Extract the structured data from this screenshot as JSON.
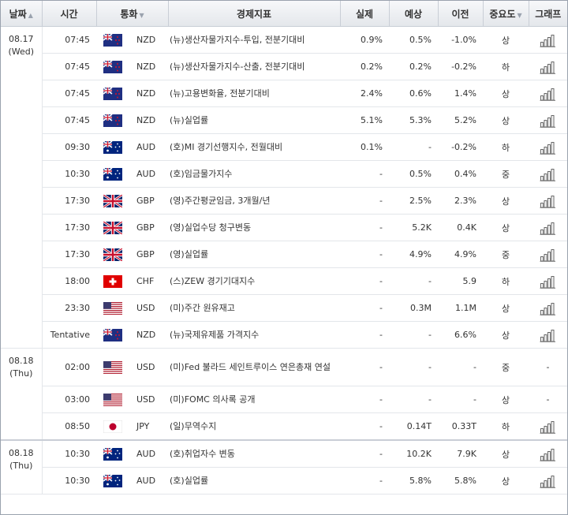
{
  "columns": {
    "date": "날짜",
    "time": "시간",
    "currency": "통화",
    "indicator": "경제지표",
    "actual": "실제",
    "forecast": "예상",
    "previous": "이전",
    "importance": "중요도",
    "graph": "그래프"
  },
  "rows": [
    {
      "date": "08.17",
      "day": "(Wed)",
      "time": "07:45",
      "flag": "nz",
      "currency": "NZD",
      "indicator": "(뉴)생산자물가지수-투입, 전분기대비",
      "actual": "0.9%",
      "forecast": "0.5%",
      "previous": "-1.0%",
      "importance": "상",
      "graph": true
    },
    {
      "time": "07:45",
      "flag": "nz",
      "currency": "NZD",
      "indicator": "(뉴)생산자물가지수-산출, 전분기대비",
      "actual": "0.2%",
      "forecast": "0.2%",
      "previous": "-0.2%",
      "importance": "하",
      "graph": true
    },
    {
      "time": "07:45",
      "flag": "nz",
      "currency": "NZD",
      "indicator": "(뉴)고용변화율, 전분기대비",
      "actual": "2.4%",
      "forecast": "0.6%",
      "previous": "1.4%",
      "importance": "상",
      "graph": true
    },
    {
      "time": "07:45",
      "flag": "nz",
      "currency": "NZD",
      "indicator": "(뉴)실업률",
      "actual": "5.1%",
      "forecast": "5.3%",
      "previous": "5.2%",
      "importance": "상",
      "graph": true
    },
    {
      "time": "09:30",
      "flag": "au",
      "currency": "AUD",
      "indicator": "(호)MI 경기선행지수, 전월대비",
      "actual": "0.1%",
      "forecast": "-",
      "previous": "-0.2%",
      "importance": "하",
      "graph": true
    },
    {
      "time": "10:30",
      "flag": "au",
      "currency": "AUD",
      "indicator": "(호)임금물가지수",
      "actual": "-",
      "forecast": "0.5%",
      "previous": "0.4%",
      "importance": "중",
      "graph": true
    },
    {
      "time": "17:30",
      "flag": "gb",
      "currency": "GBP",
      "indicator": "(영)주간평균임금, 3개월/년",
      "actual": "-",
      "forecast": "2.5%",
      "previous": "2.3%",
      "importance": "상",
      "graph": true
    },
    {
      "time": "17:30",
      "flag": "gb",
      "currency": "GBP",
      "indicator": "(영)실업수당 청구변동",
      "actual": "-",
      "forecast": "5.2K",
      "previous": "0.4K",
      "importance": "상",
      "graph": true
    },
    {
      "time": "17:30",
      "flag": "gb",
      "currency": "GBP",
      "indicator": "(영)실업률",
      "actual": "-",
      "forecast": "4.9%",
      "previous": "4.9%",
      "importance": "중",
      "graph": true
    },
    {
      "time": "18:00",
      "flag": "ch",
      "currency": "CHF",
      "indicator": "(스)ZEW 경기기대지수",
      "actual": "-",
      "forecast": "-",
      "previous": "5.9",
      "importance": "하",
      "graph": true
    },
    {
      "time": "23:30",
      "flag": "us",
      "currency": "USD",
      "indicator": "(미)주간 원유재고",
      "actual": "-",
      "forecast": "0.3M",
      "previous": "1.1M",
      "importance": "상",
      "graph": true
    },
    {
      "time": "Tentative",
      "flag": "nz",
      "currency": "NZD",
      "indicator": "(뉴)국제유제품 가격지수",
      "actual": "-",
      "forecast": "-",
      "previous": "6.6%",
      "importance": "상",
      "graph": true
    },
    {
      "date": "08.18",
      "day": "(Thu)",
      "time": "02:00",
      "flag": "us",
      "currency": "USD",
      "indicator": "(미)Fed 불라드 세인트루이스 연은총재 연설",
      "actual": "-",
      "forecast": "-",
      "previous": "-",
      "importance": "중",
      "graph": false,
      "tall": true
    },
    {
      "time": "03:00",
      "flag": "us",
      "currency": "USD",
      "indicator": "(미)FOMC 의사록 공개",
      "actual": "-",
      "forecast": "-",
      "previous": "-",
      "importance": "상",
      "graph": false
    },
    {
      "time": "08:50",
      "flag": "jp",
      "currency": "JPY",
      "indicator": "(일)무역수지",
      "actual": "-",
      "forecast": "0.14T",
      "previous": "0.33T",
      "importance": "하",
      "graph": true
    },
    {
      "date": "08.18",
      "day": "(Thu)",
      "time": "10:30",
      "flag": "au",
      "currency": "AUD",
      "indicator": "(호)취업자수 변동",
      "actual": "-",
      "forecast": "10.2K",
      "previous": "7.9K",
      "importance": "상",
      "graph": true,
      "sep": true
    },
    {
      "time": "10:30",
      "flag": "au",
      "currency": "AUD",
      "indicator": "(호)실업률",
      "actual": "-",
      "forecast": "5.8%",
      "previous": "5.8%",
      "importance": "상",
      "graph": true
    }
  ],
  "no_graph_text": "-"
}
